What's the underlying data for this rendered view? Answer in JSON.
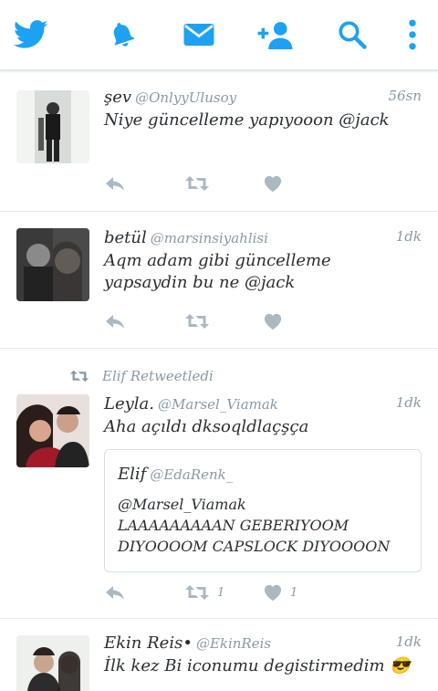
{
  "nav": {
    "items": [
      {
        "icon": "twitter-bird-icon"
      },
      {
        "icon": "bell-icon"
      },
      {
        "icon": "envelope-icon"
      },
      {
        "icon": "add-user-icon"
      },
      {
        "icon": "search-icon"
      },
      {
        "icon": "more-vertical-icon"
      }
    ],
    "accent_color": "#1da1f2"
  },
  "tweets": [
    {
      "name": "şev",
      "handle": "@OnlyyUlusoy",
      "time": "56sn",
      "text": "Niye güncelleme yapıyooon @jack"
    },
    {
      "name": "betül",
      "handle": "@marsinsiyahlisi",
      "time": "1dk",
      "text_line1": "Aqm adam gibi güncelleme",
      "text_line2": "yapsaydin bu ne @jack"
    },
    {
      "retweeted_by": "Elif Retweetledi",
      "name": "Leyla.",
      "handle": "@Marsel_Viamak",
      "time": "1dk",
      "text": "Aha açıldı dksoqldlaçşça",
      "quote": {
        "name": "Elif",
        "handle": "@EdaRenk_",
        "line1": "@Marsel_Viamak",
        "line2": "LAAAAAAAAAN GEBERIYOOM",
        "line3": "DIYOOOOM CAPSLOCK DIYOOOON"
      },
      "retweet_count": "1",
      "like_count": "1"
    },
    {
      "name": "Ekin Reis•",
      "handle": "@EkinReis",
      "time": "1dk",
      "text": "İlk kez Bi iconumu degistirmedim 😎"
    }
  ]
}
